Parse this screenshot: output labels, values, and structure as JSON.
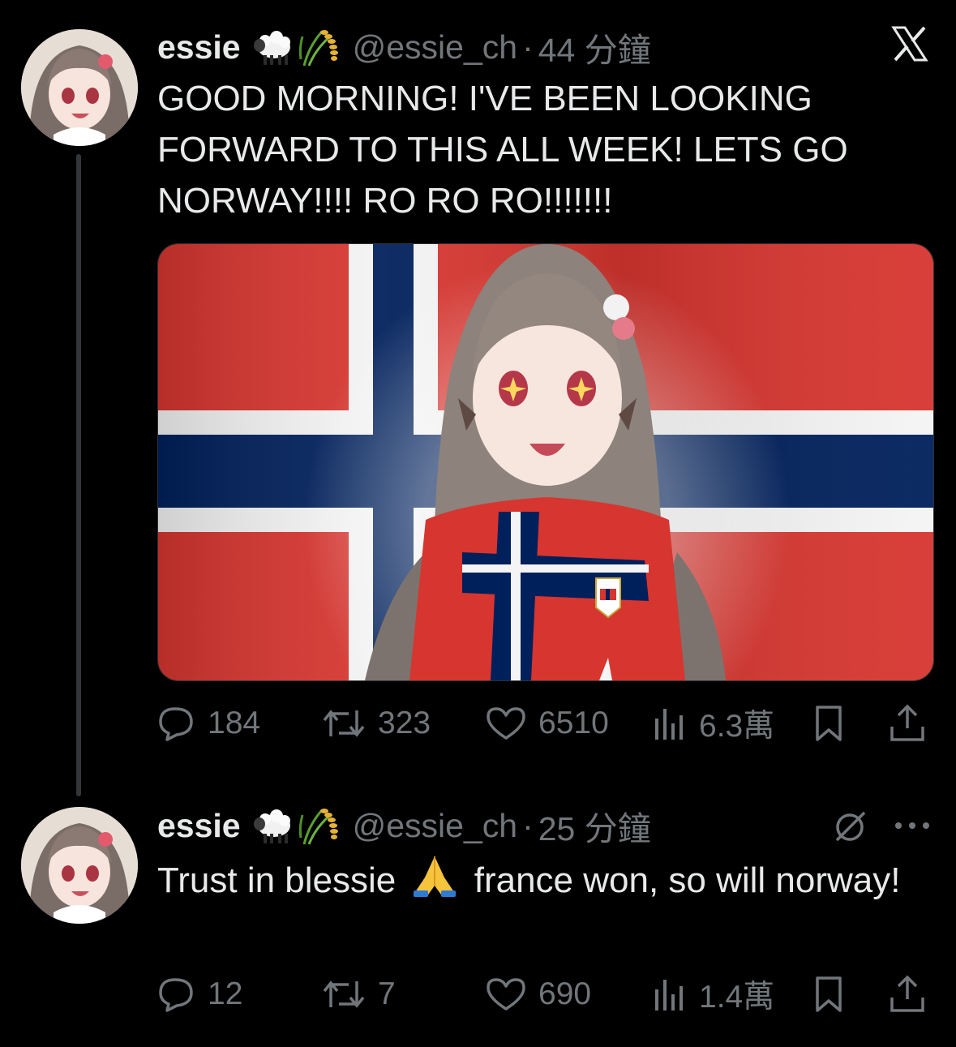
{
  "tweets": [
    {
      "name": "essie",
      "handle": "@essie_ch",
      "separator": "·",
      "time": "44 分鐘",
      "text": "GOOD MORNING! I'VE BEEN LOOKING FORWARD TO THIS ALL WEEK! LETS GO NORWAY!!!! RO RO RO!!!!!!!",
      "has_media": true,
      "stats": {
        "replies": "184",
        "reposts": "323",
        "likes": "6510",
        "views": "6.3萬"
      }
    },
    {
      "name": "essie",
      "handle": "@essie_ch",
      "separator": "·",
      "time": "25 分鐘",
      "text_before_emoji": "Trust in blessie",
      "text_after_emoji": " france won, so will norway!",
      "stats": {
        "replies": "12",
        "reposts": "7",
        "likes": "690",
        "views": "1.4萬"
      }
    }
  ],
  "icons": {
    "name_emojis": [
      "sheep-emoji",
      "rice-emoji"
    ],
    "inline_emoji": "folded-hands-emoji",
    "top_right_tweet1": "x-logo-icon",
    "top_right_tweet2": [
      "grok-icon",
      "more-icon"
    ]
  },
  "colors": {
    "background": "#000000",
    "text": "#e7e9ea",
    "secondary": "#71767b",
    "thread_line": "#333639",
    "flag_red": "#d7352f",
    "flag_blue": "#00205b"
  }
}
